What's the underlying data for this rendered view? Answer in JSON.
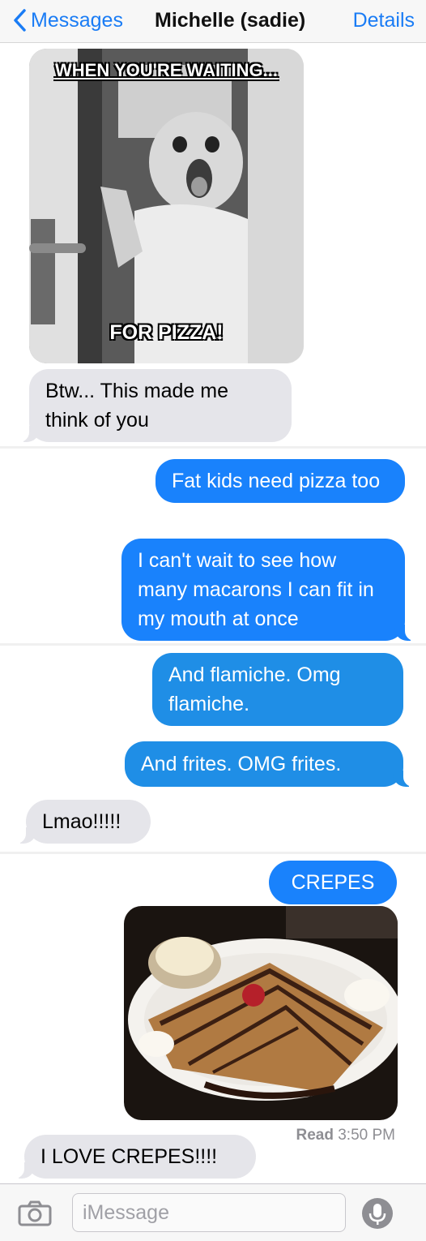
{
  "nav": {
    "back_label": "Messages",
    "title": "Michelle (sadie)",
    "details_label": "Details"
  },
  "meme": {
    "top_text": "WHEN YOU'RE WAITING...",
    "bottom_text": "FOR PIZZA!"
  },
  "messages": [
    {
      "dir": "in",
      "text": "Btw... This made me think of you"
    },
    {
      "dir": "out",
      "text": "Fat kids need pizza too"
    },
    {
      "dir": "out",
      "text": "I can't wait to see how many macarons I can fit in my mouth at once"
    },
    {
      "dir": "out",
      "text": "And flamiche. Omg flamiche."
    },
    {
      "dir": "out",
      "text": "And frites. OMG frites."
    },
    {
      "dir": "in",
      "text": "Lmao!!!!!"
    },
    {
      "dir": "out",
      "text": "CREPES"
    },
    {
      "dir": "in",
      "text": "I LOVE CREPES!!!!"
    }
  ],
  "receipt": {
    "label": "Read",
    "time": "3:50 PM"
  },
  "composer": {
    "placeholder": "iMessage"
  },
  "colors": {
    "accent": "#1a7cf5",
    "outgoing": "#1982fc",
    "incoming": "#e5e5ea"
  }
}
